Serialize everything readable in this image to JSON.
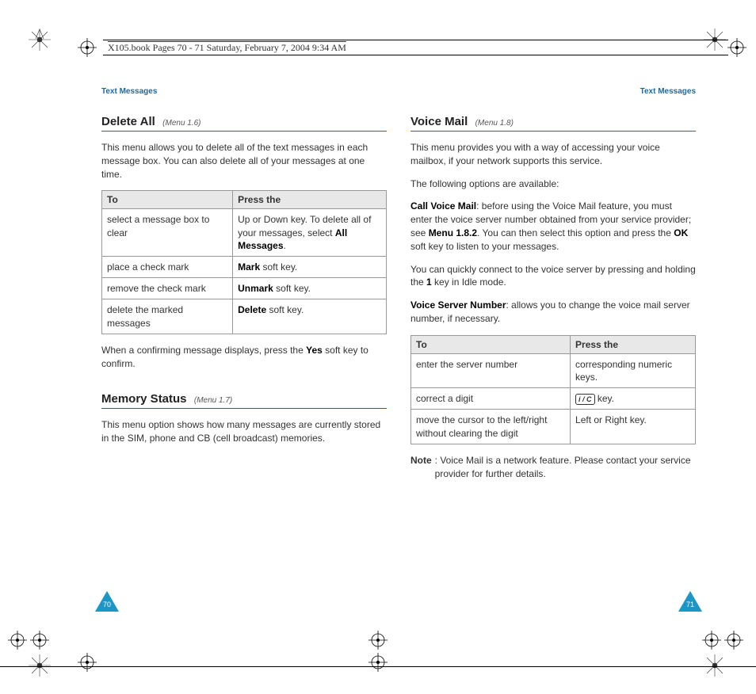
{
  "meta": {
    "header_line": "X105.book  Pages 70 - 71  Saturday, February 7, 2004  9:34 AM"
  },
  "left": {
    "chapter_label": "Text Messages",
    "section1": {
      "title": "Delete All",
      "menu_tag": "(Menu 1.6)",
      "intro": "This menu allows you to delete all of the text messages in each message box. You can also delete all of your messages at one time.",
      "table": {
        "head": {
          "col1": "To",
          "col2": "Press the"
        },
        "rows": [
          {
            "to": "select a message box to clear",
            "press_pre": "Up or Down key. To delete all of your messages, select ",
            "press_bold": "All Messages",
            "press_post": "."
          },
          {
            "to": "place a check mark",
            "press_bold": "Mark",
            "press_post": " soft key."
          },
          {
            "to": "remove the check mark",
            "press_bold": "Unmark",
            "press_post": " soft key."
          },
          {
            "to": "delete the marked messages",
            "press_bold": "Delete",
            "press_post": " soft key."
          }
        ]
      },
      "confirm_pre": "When a confirming message displays, press the ",
      "confirm_bold": "Yes",
      "confirm_post": " soft key to confirm."
    },
    "section2": {
      "title": "Memory Status",
      "menu_tag": "(Menu 1.7)",
      "body": "This menu option shows how many messages are currently stored in the SIM, phone and CB (cell broadcast) memories."
    },
    "page_number": "70"
  },
  "right": {
    "chapter_label": "Text Messages",
    "section1": {
      "title": "Voice Mail",
      "menu_tag": "(Menu 1.8)",
      "intro": "This menu provides you with a way of accessing your voice mailbox, if your network supports this service.",
      "options_line": "The following options are available:",
      "call_vm": {
        "label": "Call Voice Mail",
        "text_pre": ": before using the Voice Mail feature, you must enter the voice server number obtained from your service provider; see ",
        "bold1": "Menu 1.8.2",
        "text_mid": ". You can then select this option and press the ",
        "bold2": "OK",
        "text_post": " soft key to listen to your messages."
      },
      "quick_pre": "You can quickly connect to the voice server by pressing and holding the ",
      "quick_bold": "1",
      "quick_post": " key in Idle mode.",
      "vsn": {
        "label": "Voice Server Number",
        "text": ": allows you to change the voice mail server number, if necessary."
      },
      "table": {
        "head": {
          "col1": "To",
          "col2": "Press the"
        },
        "rows": [
          {
            "to": "enter the server number",
            "press": "corresponding numeric keys."
          },
          {
            "to": "correct a digit",
            "press_icon_label": "i / C",
            "press_suffix": " key."
          },
          {
            "to": "move the cursor to the left/right without clearing the digit",
            "press": "Left or Right key."
          }
        ]
      },
      "note": {
        "label": "Note",
        "text": ": Voice Mail is a network feature. Please contact your service provider for further details."
      }
    },
    "page_number": "71"
  }
}
